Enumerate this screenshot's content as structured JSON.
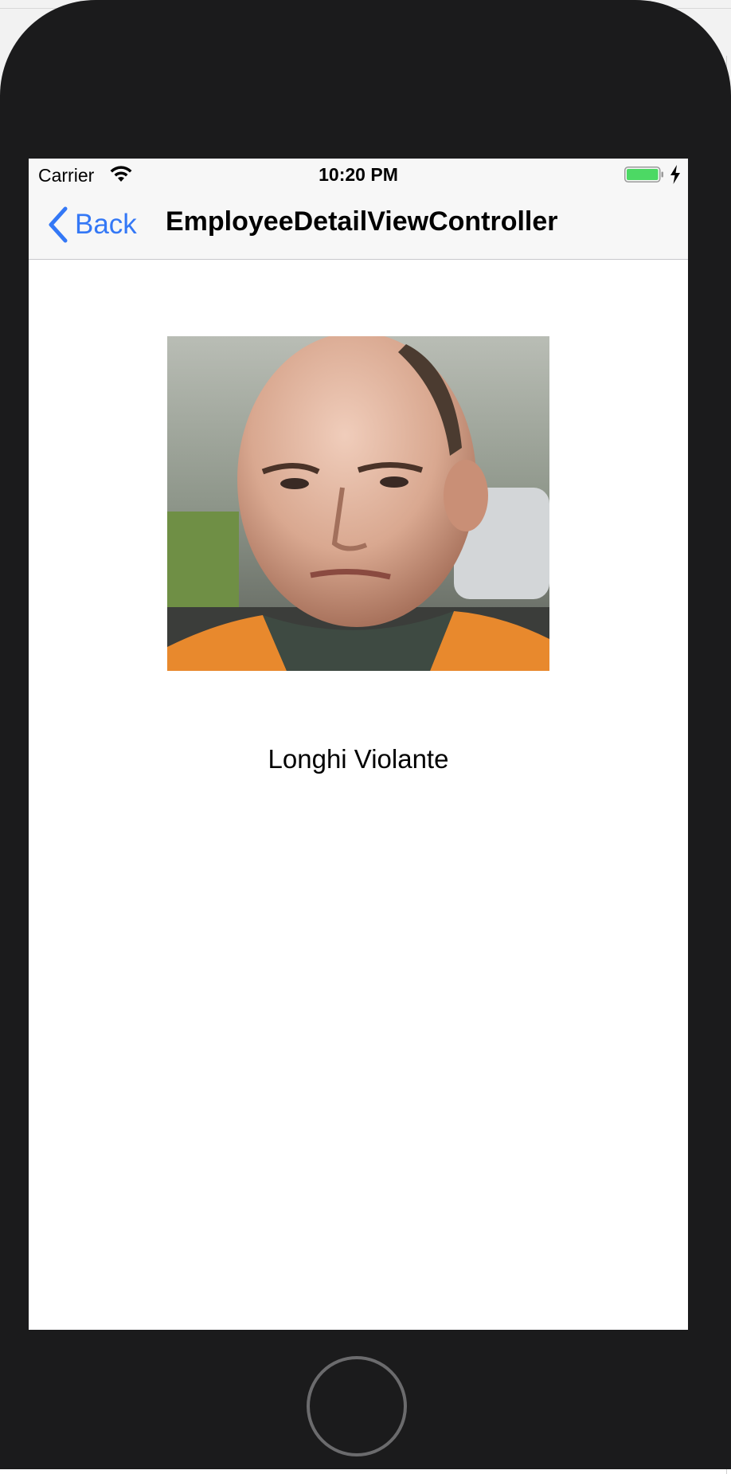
{
  "status_bar": {
    "carrier": "Carrier",
    "time": "10:20 PM",
    "wifi_icon": "wifi-icon",
    "battery_icon": "battery-full-icon",
    "charging_icon": "charging-bolt-icon",
    "battery_color": "#4cd964"
  },
  "nav": {
    "back_label": "Back",
    "back_icon": "chevron-left-icon",
    "title": "EmployeeDetailViewController",
    "accent_color": "#3478f6"
  },
  "employee": {
    "photo": "employee-photo",
    "name": "Longhi Violante"
  },
  "device": {
    "home_button": "home-button"
  }
}
